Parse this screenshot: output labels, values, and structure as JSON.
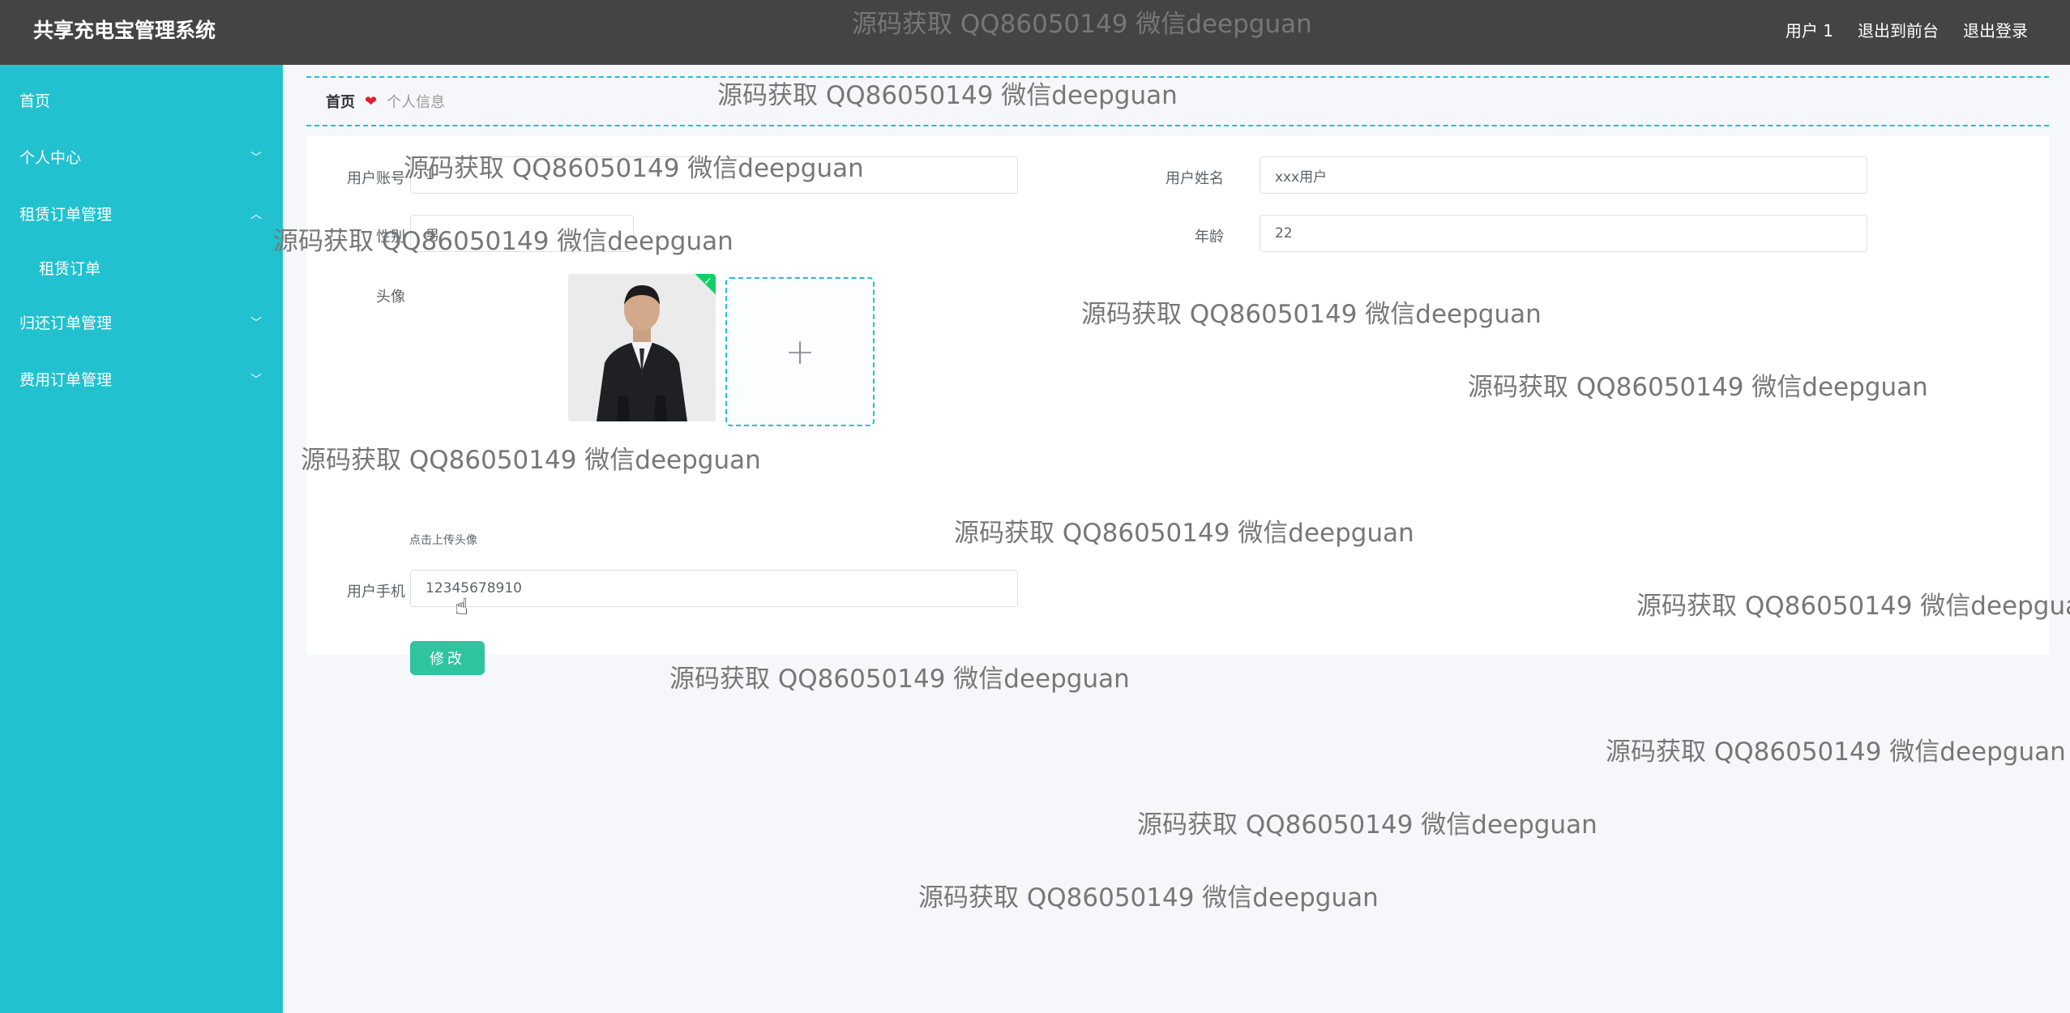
{
  "header": {
    "title": "共享充电宝管理系统",
    "links": [
      "用户 1",
      "退出到前台",
      "退出登录"
    ]
  },
  "sidebar": {
    "items": [
      {
        "label": "首页"
      },
      {
        "label": "个人中心"
      },
      {
        "label": "租赁订单管理"
      },
      {
        "label": "租赁订单"
      },
      {
        "label": "归还订单管理"
      },
      {
        "label": "费用订单管理"
      }
    ]
  },
  "breadcrumb": {
    "home": "首页",
    "separator": "❤",
    "current": "个人信息"
  },
  "form": {
    "account_label": "用户账号",
    "account_value": "1",
    "name_label": "用户姓名",
    "name_value": "xxx用户",
    "gender_label": "性别",
    "gender_value": "男",
    "age_label": "年龄",
    "age_value": "22",
    "avatar_label": "头像",
    "upload_tip": "点击上传头像",
    "phone_label": "用户手机",
    "phone_value": "12345678910",
    "submit_label": "修改"
  },
  "watermark": "源码获取 QQ86050149 微信deepguan",
  "colors": {
    "header_bg": "#444444",
    "sidebar_bg": "#22c1cf",
    "accent": "#2ec4a0"
  }
}
